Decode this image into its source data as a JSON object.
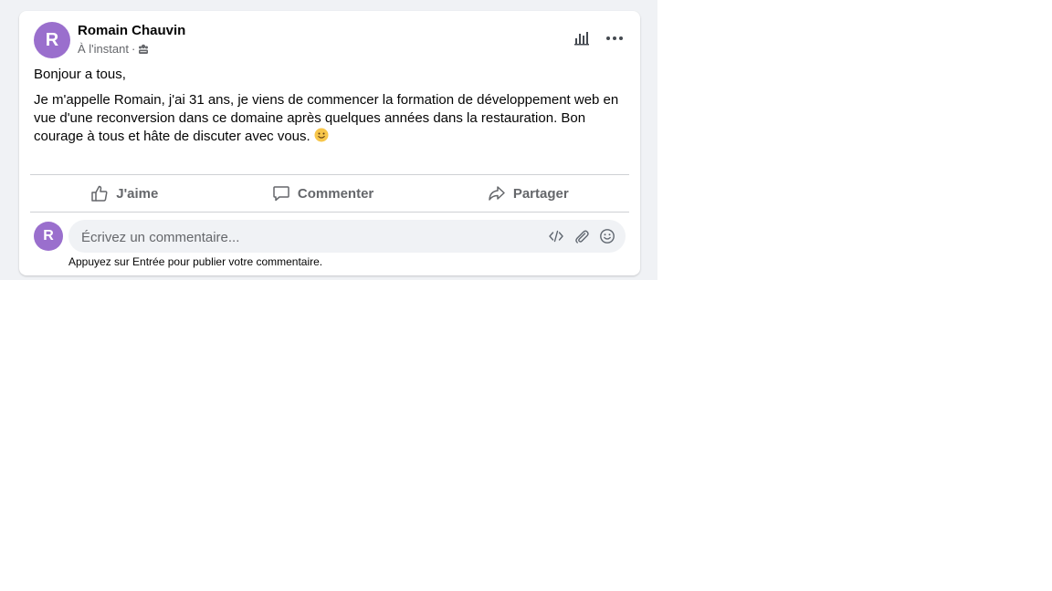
{
  "post": {
    "author": {
      "name": "Romain Chauvin",
      "initial": "R"
    },
    "timestamp": "À l'instant",
    "meta_separator": "·",
    "audience_icon": "group-icon",
    "greeting": "Bonjour a tous,",
    "body": "Je m'appelle Romain, j'ai 31 ans, je viens de commencer la formation de développement web en vue d'une reconversion dans ce domaine après quelques années dans la restauration. Bon courage à tous et hâte de discuter avec vous.",
    "body_emoji": "slightly-smiling-face-icon"
  },
  "header_actions": {
    "insights_icon": "bar-chart-icon",
    "more_icon": "more-horizontal-icon"
  },
  "actions": {
    "like_label": "J'aime",
    "comment_label": "Commenter",
    "share_label": "Partager"
  },
  "comment": {
    "avatar_initial": "R",
    "placeholder": "Écrivez un commentaire...",
    "hint": "Appuyez sur Entrée pour publier votre commentaire.",
    "tools": [
      "code-icon",
      "paperclip-icon",
      "smiley-icon"
    ]
  },
  "colors": {
    "avatar": "#9a6fcd",
    "muted_text": "#65676b",
    "input_bg": "#f0f2f5",
    "divider": "#ced0d4"
  }
}
